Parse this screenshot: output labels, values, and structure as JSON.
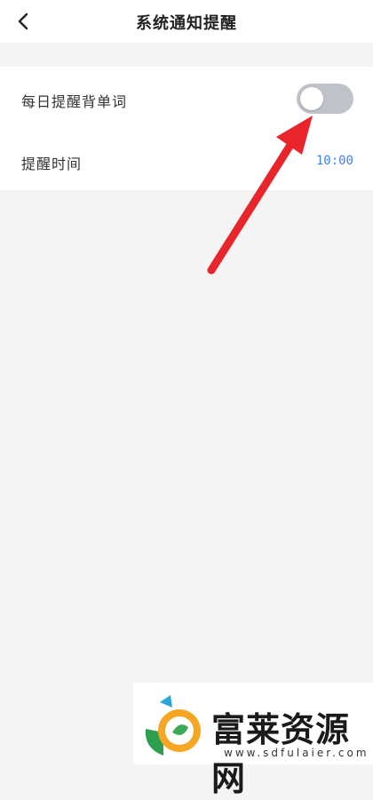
{
  "header": {
    "title": "系统通知提醒"
  },
  "settings": {
    "daily_reminder": {
      "label": "每日提醒背单词",
      "enabled": false
    },
    "reminder_time": {
      "label": "提醒时间",
      "value": "10:00"
    }
  },
  "watermark": {
    "brand": "富莱资源网",
    "url": "www.sdfulaier.com"
  },
  "colors": {
    "accent": "#3b82f6",
    "toggle_off": "#bfc3c9",
    "arrow": "#e8252b"
  }
}
